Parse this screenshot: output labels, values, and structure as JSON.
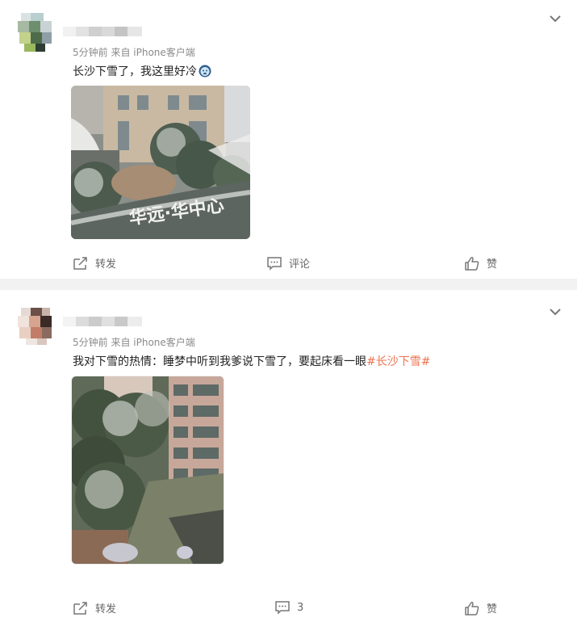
{
  "posts": [
    {
      "meta": "5分钟前  来自 iPhone客户端",
      "text": "长沙下雪了，我这里好冷",
      "hashtag": "",
      "photo_sign": "华远·华中心",
      "actions": {
        "forward": "转发",
        "comment": "评论",
        "like": "赞"
      }
    },
    {
      "meta": "5分钟前  来自 iPhone客户端",
      "text": "我对下雪的热情：睡梦中听到我爹说下雪了，要起床看一眼",
      "hashtag": "#长沙下雪#",
      "actions": {
        "forward": "转发",
        "comment": "3",
        "like": "赞"
      }
    }
  ],
  "colors": {
    "hashtag": "#eb7350",
    "divider": "#f2f2f2",
    "meta": "#8a8a8a"
  }
}
